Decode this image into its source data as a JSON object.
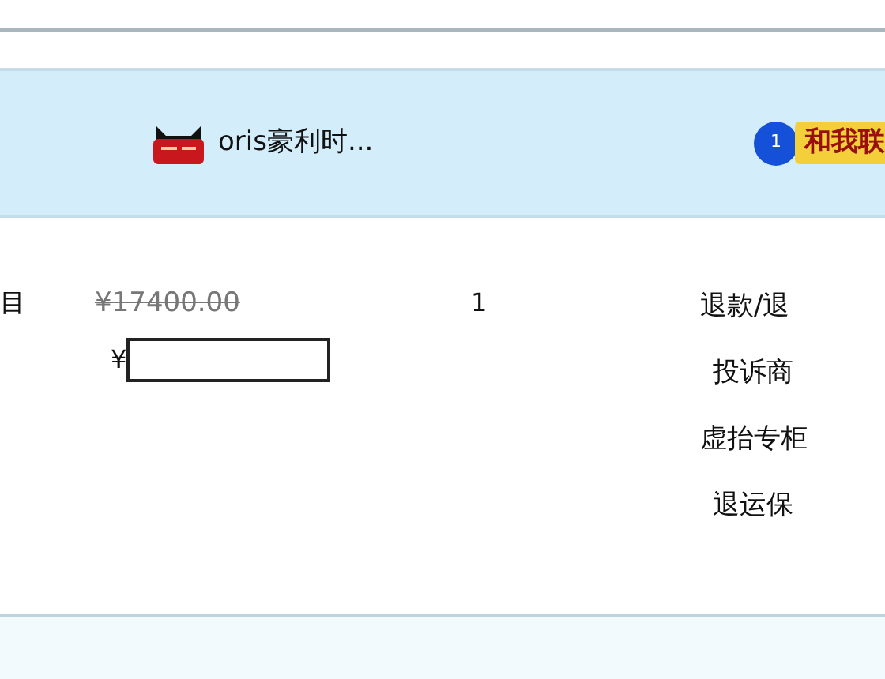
{
  "shop": {
    "name": "oris豪利时...",
    "contact_label": "和我联",
    "unread_count": "1"
  },
  "item": {
    "title_fragment": "目",
    "original_price": "¥17400.00",
    "currency": "¥",
    "quantity": "1",
    "actions": [
      "退款/退",
      "投诉商",
      "虚抬专柜",
      "退运保"
    ]
  }
}
